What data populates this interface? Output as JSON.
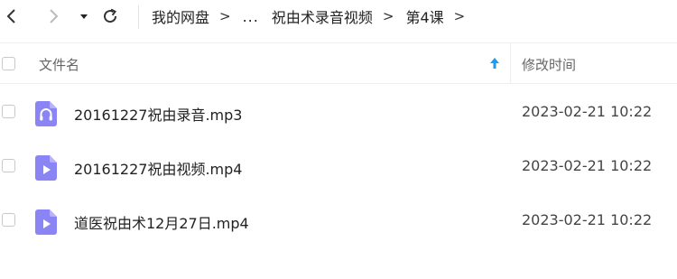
{
  "toolbar": {
    "back_icon": "chevron-left-icon",
    "forward_icon": "chevron-right-icon",
    "history_icon": "caret-down-icon",
    "refresh_icon": "refresh-icon"
  },
  "breadcrumb": {
    "root": "我的网盘",
    "sep": ">",
    "ellipsis": "...",
    "folder1": "祝由术录音视频",
    "folder2": "第4课"
  },
  "table": {
    "columns": {
      "name": "文件名",
      "time": "修改时间"
    },
    "sort_icon": "sort-up-arrow-icon",
    "accent": "#1a9cf0",
    "rows": [
      {
        "name": "20161227祝由录音.mp3",
        "time": "2023-02-21 10:22",
        "icon": "audio-file-icon"
      },
      {
        "name": "20161227祝由视频.mp4",
        "time": "2023-02-21 10:22",
        "icon": "video-file-icon"
      },
      {
        "name": "道医祝由术12月27日.mp4",
        "time": "2023-02-21 10:22",
        "icon": "video-file-icon"
      }
    ]
  },
  "colors": {
    "file_icon": "#8a84f5"
  }
}
